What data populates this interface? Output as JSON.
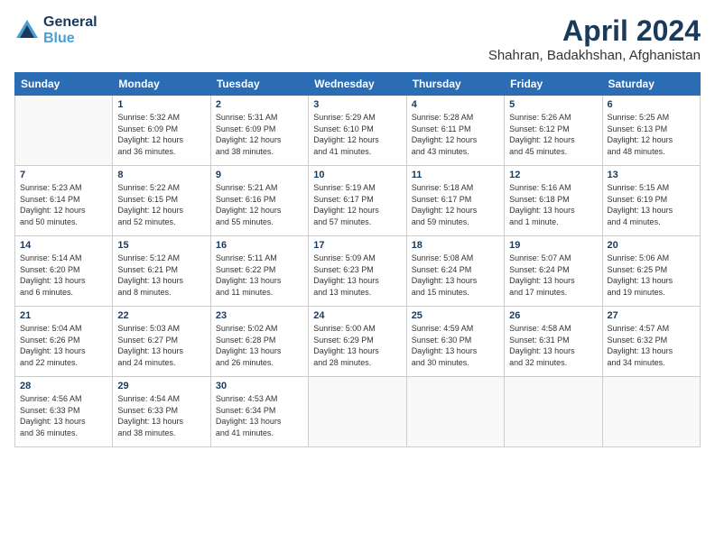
{
  "logo": {
    "line1": "General",
    "line2": "Blue"
  },
  "title": "April 2024",
  "subtitle": "Shahran, Badakhshan, Afghanistan",
  "header_days": [
    "Sunday",
    "Monday",
    "Tuesday",
    "Wednesday",
    "Thursday",
    "Friday",
    "Saturday"
  ],
  "weeks": [
    [
      {
        "day": "",
        "info": ""
      },
      {
        "day": "1",
        "info": "Sunrise: 5:32 AM\nSunset: 6:09 PM\nDaylight: 12 hours\nand 36 minutes."
      },
      {
        "day": "2",
        "info": "Sunrise: 5:31 AM\nSunset: 6:09 PM\nDaylight: 12 hours\nand 38 minutes."
      },
      {
        "day": "3",
        "info": "Sunrise: 5:29 AM\nSunset: 6:10 PM\nDaylight: 12 hours\nand 41 minutes."
      },
      {
        "day": "4",
        "info": "Sunrise: 5:28 AM\nSunset: 6:11 PM\nDaylight: 12 hours\nand 43 minutes."
      },
      {
        "day": "5",
        "info": "Sunrise: 5:26 AM\nSunset: 6:12 PM\nDaylight: 12 hours\nand 45 minutes."
      },
      {
        "day": "6",
        "info": "Sunrise: 5:25 AM\nSunset: 6:13 PM\nDaylight: 12 hours\nand 48 minutes."
      }
    ],
    [
      {
        "day": "7",
        "info": "Sunrise: 5:23 AM\nSunset: 6:14 PM\nDaylight: 12 hours\nand 50 minutes."
      },
      {
        "day": "8",
        "info": "Sunrise: 5:22 AM\nSunset: 6:15 PM\nDaylight: 12 hours\nand 52 minutes."
      },
      {
        "day": "9",
        "info": "Sunrise: 5:21 AM\nSunset: 6:16 PM\nDaylight: 12 hours\nand 55 minutes."
      },
      {
        "day": "10",
        "info": "Sunrise: 5:19 AM\nSunset: 6:17 PM\nDaylight: 12 hours\nand 57 minutes."
      },
      {
        "day": "11",
        "info": "Sunrise: 5:18 AM\nSunset: 6:17 PM\nDaylight: 12 hours\nand 59 minutes."
      },
      {
        "day": "12",
        "info": "Sunrise: 5:16 AM\nSunset: 6:18 PM\nDaylight: 13 hours\nand 1 minute."
      },
      {
        "day": "13",
        "info": "Sunrise: 5:15 AM\nSunset: 6:19 PM\nDaylight: 13 hours\nand 4 minutes."
      }
    ],
    [
      {
        "day": "14",
        "info": "Sunrise: 5:14 AM\nSunset: 6:20 PM\nDaylight: 13 hours\nand 6 minutes."
      },
      {
        "day": "15",
        "info": "Sunrise: 5:12 AM\nSunset: 6:21 PM\nDaylight: 13 hours\nand 8 minutes."
      },
      {
        "day": "16",
        "info": "Sunrise: 5:11 AM\nSunset: 6:22 PM\nDaylight: 13 hours\nand 11 minutes."
      },
      {
        "day": "17",
        "info": "Sunrise: 5:09 AM\nSunset: 6:23 PM\nDaylight: 13 hours\nand 13 minutes."
      },
      {
        "day": "18",
        "info": "Sunrise: 5:08 AM\nSunset: 6:24 PM\nDaylight: 13 hours\nand 15 minutes."
      },
      {
        "day": "19",
        "info": "Sunrise: 5:07 AM\nSunset: 6:24 PM\nDaylight: 13 hours\nand 17 minutes."
      },
      {
        "day": "20",
        "info": "Sunrise: 5:06 AM\nSunset: 6:25 PM\nDaylight: 13 hours\nand 19 minutes."
      }
    ],
    [
      {
        "day": "21",
        "info": "Sunrise: 5:04 AM\nSunset: 6:26 PM\nDaylight: 13 hours\nand 22 minutes."
      },
      {
        "day": "22",
        "info": "Sunrise: 5:03 AM\nSunset: 6:27 PM\nDaylight: 13 hours\nand 24 minutes."
      },
      {
        "day": "23",
        "info": "Sunrise: 5:02 AM\nSunset: 6:28 PM\nDaylight: 13 hours\nand 26 minutes."
      },
      {
        "day": "24",
        "info": "Sunrise: 5:00 AM\nSunset: 6:29 PM\nDaylight: 13 hours\nand 28 minutes."
      },
      {
        "day": "25",
        "info": "Sunrise: 4:59 AM\nSunset: 6:30 PM\nDaylight: 13 hours\nand 30 minutes."
      },
      {
        "day": "26",
        "info": "Sunrise: 4:58 AM\nSunset: 6:31 PM\nDaylight: 13 hours\nand 32 minutes."
      },
      {
        "day": "27",
        "info": "Sunrise: 4:57 AM\nSunset: 6:32 PM\nDaylight: 13 hours\nand 34 minutes."
      }
    ],
    [
      {
        "day": "28",
        "info": "Sunrise: 4:56 AM\nSunset: 6:33 PM\nDaylight: 13 hours\nand 36 minutes."
      },
      {
        "day": "29",
        "info": "Sunrise: 4:54 AM\nSunset: 6:33 PM\nDaylight: 13 hours\nand 38 minutes."
      },
      {
        "day": "30",
        "info": "Sunrise: 4:53 AM\nSunset: 6:34 PM\nDaylight: 13 hours\nand 41 minutes."
      },
      {
        "day": "",
        "info": ""
      },
      {
        "day": "",
        "info": ""
      },
      {
        "day": "",
        "info": ""
      },
      {
        "day": "",
        "info": ""
      }
    ]
  ]
}
